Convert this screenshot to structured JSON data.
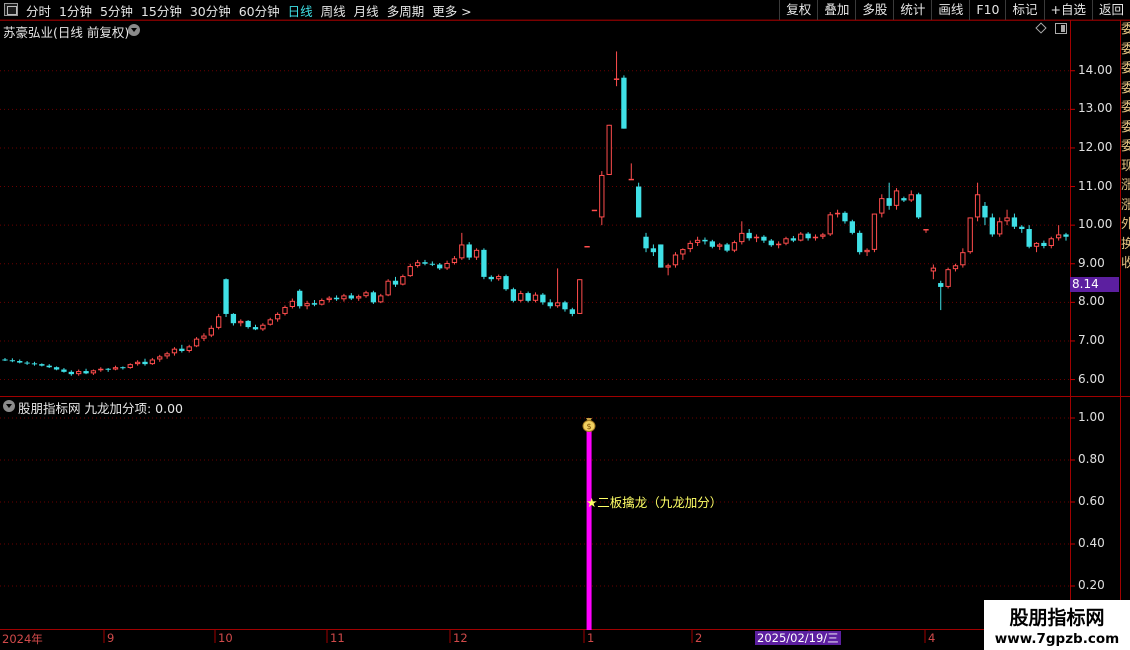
{
  "toolbar": {
    "period_tabs": [
      {
        "label": "分时",
        "active": false
      },
      {
        "label": "1分钟",
        "active": false
      },
      {
        "label": "5分钟",
        "active": false
      },
      {
        "label": "15分钟",
        "active": false
      },
      {
        "label": "30分钟",
        "active": false
      },
      {
        "label": "60分钟",
        "active": false
      },
      {
        "label": "日线",
        "active": true
      },
      {
        "label": "周线",
        "active": false
      },
      {
        "label": "月线",
        "active": false
      },
      {
        "label": "多周期",
        "active": false
      },
      {
        "label": "更多 >",
        "active": false
      }
    ],
    "right_tools": [
      "复权",
      "叠加",
      "多股",
      "统计",
      "画线",
      "F10",
      "标记",
      "+自选",
      "返回"
    ]
  },
  "main_chart": {
    "title": "苏豪弘业(日线 前复权)",
    "y_ticks": [
      "14.00",
      "13.00",
      "12.00",
      "11.00",
      "10.00",
      "9.00",
      "8.00",
      "7.00",
      "6.00"
    ],
    "current_price_tag": "8.14"
  },
  "indicator": {
    "title": "股朋指标网 九龙加分项: 0.00",
    "y_ticks": [
      "1.00",
      "0.80",
      "0.60",
      "0.40",
      "0.20"
    ],
    "signal_label": "★二板擒龙（九龙加分）"
  },
  "date_axis": {
    "labels": [
      "2024年",
      "9",
      "10",
      "11",
      "12",
      "1",
      "2",
      "3",
      "4"
    ],
    "cursor_date": "2025/02/19/三"
  },
  "side_column": [
    "委",
    "委",
    "委",
    "委",
    "委",
    "委",
    "委",
    "现",
    "涨",
    "涨",
    "外",
    "换",
    "收"
  ],
  "watermark": {
    "name": "股朋指标网",
    "url": "www.7gpzb.com"
  },
  "colors": {
    "up": "#ff4d4d",
    "down": "#3fe0e6",
    "grid": "#8a0000",
    "signal": "#ff00ff",
    "cursor": "#5c1fa0"
  },
  "chart_data": {
    "type": "candlestick",
    "price_range": [
      5.6,
      14.9
    ],
    "indicator_range": [
      0,
      1.1
    ],
    "candles": [
      [
        6.52,
        6.56,
        6.48,
        6.5
      ],
      [
        6.5,
        6.55,
        6.45,
        6.48
      ],
      [
        6.48,
        6.52,
        6.42,
        6.44
      ],
      [
        6.44,
        6.48,
        6.38,
        6.42
      ],
      [
        6.42,
        6.46,
        6.36,
        6.4
      ],
      [
        6.4,
        6.42,
        6.34,
        6.36
      ],
      [
        6.36,
        6.4,
        6.3,
        6.32
      ],
      [
        6.32,
        6.34,
        6.24,
        6.26
      ],
      [
        6.26,
        6.3,
        6.18,
        6.2
      ],
      [
        6.2,
        6.24,
        6.1,
        6.14
      ],
      [
        6.14,
        6.26,
        6.1,
        6.22
      ],
      [
        6.22,
        6.28,
        6.14,
        6.16
      ],
      [
        6.16,
        6.26,
        6.12,
        6.24
      ],
      [
        6.24,
        6.32,
        6.2,
        6.28
      ],
      [
        6.28,
        6.3,
        6.2,
        6.26
      ],
      [
        6.26,
        6.36,
        6.24,
        6.32
      ],
      [
        6.32,
        6.34,
        6.26,
        6.3
      ],
      [
        6.3,
        6.42,
        6.28,
        6.4
      ],
      [
        6.4,
        6.5,
        6.36,
        6.46
      ],
      [
        6.46,
        6.54,
        6.36,
        6.4
      ],
      [
        6.4,
        6.56,
        6.38,
        6.52
      ],
      [
        6.52,
        6.64,
        6.46,
        6.6
      ],
      [
        6.6,
        6.72,
        6.54,
        6.68
      ],
      [
        6.68,
        6.84,
        6.62,
        6.8
      ],
      [
        6.8,
        6.9,
        6.7,
        6.74
      ],
      [
        6.74,
        6.9,
        6.7,
        6.86
      ],
      [
        6.86,
        7.1,
        6.84,
        7.06
      ],
      [
        7.06,
        7.2,
        7.0,
        7.14
      ],
      [
        7.14,
        7.4,
        7.1,
        7.34
      ],
      [
        7.34,
        7.7,
        7.3,
        7.64
      ],
      [
        8.6,
        8.62,
        7.62,
        7.7
      ],
      [
        7.7,
        7.72,
        7.4,
        7.46
      ],
      [
        7.46,
        7.56,
        7.38,
        7.52
      ],
      [
        7.52,
        7.54,
        7.32,
        7.36
      ],
      [
        7.36,
        7.42,
        7.28,
        7.3
      ],
      [
        7.3,
        7.46,
        7.26,
        7.42
      ],
      [
        7.42,
        7.6,
        7.4,
        7.56
      ],
      [
        7.56,
        7.74,
        7.5,
        7.7
      ],
      [
        7.7,
        7.92,
        7.66,
        7.88
      ],
      [
        7.88,
        8.1,
        7.84,
        8.04
      ],
      [
        8.3,
        8.34,
        7.84,
        7.9
      ],
      [
        7.9,
        8.04,
        7.82,
        7.98
      ],
      [
        7.98,
        8.06,
        7.9,
        7.94
      ],
      [
        7.94,
        8.1,
        7.92,
        8.06
      ],
      [
        8.06,
        8.16,
        8.0,
        8.12
      ],
      [
        8.12,
        8.18,
        8.04,
        8.08
      ],
      [
        8.08,
        8.22,
        8.02,
        8.18
      ],
      [
        8.18,
        8.24,
        8.06,
        8.1
      ],
      [
        8.1,
        8.2,
        8.04,
        8.16
      ],
      [
        8.16,
        8.3,
        8.12,
        8.26
      ],
      [
        8.26,
        8.3,
        7.96,
        8.0
      ],
      [
        8.0,
        8.22,
        7.98,
        8.18
      ],
      [
        8.18,
        8.6,
        8.16,
        8.56
      ],
      [
        8.56,
        8.66,
        8.4,
        8.46
      ],
      [
        8.46,
        8.72,
        8.44,
        8.68
      ],
      [
        8.68,
        9.0,
        8.66,
        8.94
      ],
      [
        8.94,
        9.1,
        8.9,
        9.04
      ],
      [
        9.04,
        9.1,
        8.96,
        9.0
      ],
      [
        9.0,
        9.06,
        8.94,
        8.98
      ],
      [
        8.98,
        9.02,
        8.84,
        8.88
      ],
      [
        8.88,
        9.08,
        8.84,
        9.02
      ],
      [
        9.02,
        9.2,
        8.98,
        9.14
      ],
      [
        9.14,
        9.8,
        9.1,
        9.5
      ],
      [
        9.5,
        9.56,
        9.1,
        9.16
      ],
      [
        9.16,
        9.4,
        9.1,
        9.36
      ],
      [
        9.36,
        9.4,
        8.6,
        8.66
      ],
      [
        8.66,
        8.7,
        8.54,
        8.6
      ],
      [
        8.6,
        8.72,
        8.56,
        8.68
      ],
      [
        8.68,
        8.72,
        8.3,
        8.34
      ],
      [
        8.34,
        8.38,
        8.0,
        8.04
      ],
      [
        8.04,
        8.3,
        8.0,
        8.24
      ],
      [
        8.24,
        8.28,
        8.0,
        8.04
      ],
      [
        8.04,
        8.26,
        8.0,
        8.2
      ],
      [
        8.2,
        8.24,
        7.94,
        8.0
      ],
      [
        8.0,
        8.08,
        7.84,
        7.9
      ],
      [
        7.9,
        8.88,
        7.86,
        8.0
      ],
      [
        8.0,
        8.04,
        7.76,
        7.82
      ],
      [
        7.82,
        7.86,
        7.64,
        7.7
      ],
      [
        7.7,
        8.6,
        7.7,
        8.6
      ],
      [
        9.46,
        9.46,
        9.46,
        9.46
      ],
      [
        10.4,
        10.4,
        10.4,
        10.4
      ],
      [
        10.2,
        11.4,
        10.0,
        11.3
      ],
      [
        11.3,
        12.6,
        11.3,
        12.6
      ],
      [
        13.8,
        14.5,
        13.6,
        13.8
      ],
      [
        13.82,
        13.88,
        12.5,
        12.5
      ],
      [
        11.2,
        11.6,
        11.2,
        11.2
      ],
      [
        11.0,
        11.1,
        10.2,
        10.2
      ],
      [
        9.7,
        9.8,
        9.3,
        9.4
      ],
      [
        9.4,
        9.5,
        9.2,
        9.3
      ],
      [
        9.5,
        9.5,
        8.9,
        8.9
      ],
      [
        8.9,
        9.0,
        8.7,
        8.96
      ],
      [
        8.96,
        9.3,
        8.9,
        9.24
      ],
      [
        9.24,
        9.4,
        9.1,
        9.38
      ],
      [
        9.38,
        9.6,
        9.3,
        9.54
      ],
      [
        9.54,
        9.7,
        9.46,
        9.62
      ],
      [
        9.62,
        9.68,
        9.5,
        9.58
      ],
      [
        9.58,
        9.62,
        9.4,
        9.44
      ],
      [
        9.44,
        9.54,
        9.36,
        9.5
      ],
      [
        9.5,
        9.54,
        9.3,
        9.34
      ],
      [
        9.34,
        9.6,
        9.3,
        9.56
      ],
      [
        9.56,
        10.1,
        9.5,
        9.8
      ],
      [
        9.8,
        9.9,
        9.6,
        9.66
      ],
      [
        9.66,
        9.76,
        9.56,
        9.7
      ],
      [
        9.7,
        9.74,
        9.54,
        9.6
      ],
      [
        9.6,
        9.64,
        9.44,
        9.48
      ],
      [
        9.48,
        9.58,
        9.4,
        9.52
      ],
      [
        9.52,
        9.7,
        9.48,
        9.66
      ],
      [
        9.66,
        9.72,
        9.56,
        9.6
      ],
      [
        9.6,
        9.82,
        9.58,
        9.78
      ],
      [
        9.78,
        9.82,
        9.6,
        9.66
      ],
      [
        9.66,
        9.76,
        9.6,
        9.7
      ],
      [
        9.7,
        9.8,
        9.64,
        9.76
      ],
      [
        9.76,
        10.34,
        9.72,
        10.28
      ],
      [
        10.28,
        10.4,
        10.2,
        10.32
      ],
      [
        10.32,
        10.36,
        10.04,
        10.1
      ],
      [
        10.1,
        10.14,
        9.76,
        9.8
      ],
      [
        9.8,
        9.86,
        9.24,
        9.3
      ],
      [
        9.3,
        9.4,
        9.2,
        9.36
      ],
      [
        9.36,
        10.3,
        9.3,
        10.3
      ],
      [
        10.3,
        10.8,
        10.2,
        10.7
      ],
      [
        10.7,
        11.1,
        10.4,
        10.5
      ],
      [
        10.5,
        10.96,
        10.4,
        10.9
      ],
      [
        10.7,
        10.74,
        10.6,
        10.64
      ],
      [
        10.64,
        10.9,
        10.6,
        10.8
      ],
      [
        10.8,
        10.84,
        10.16,
        10.2
      ],
      [
        9.9,
        9.9,
        9.8,
        9.9
      ],
      [
        8.8,
        8.98,
        8.6,
        8.9
      ],
      [
        8.5,
        8.56,
        7.8,
        8.4
      ],
      [
        8.4,
        8.9,
        8.36,
        8.86
      ],
      [
        8.86,
        9.0,
        8.8,
        8.96
      ],
      [
        8.96,
        9.4,
        8.9,
        9.3
      ],
      [
        9.3,
        10.2,
        9.26,
        10.2
      ],
      [
        10.2,
        11.1,
        10.1,
        10.8
      ],
      [
        10.5,
        10.6,
        10.0,
        10.2
      ],
      [
        10.2,
        10.3,
        9.7,
        9.76
      ],
      [
        9.76,
        10.2,
        9.7,
        10.1
      ],
      [
        10.1,
        10.4,
        10.0,
        10.2
      ],
      [
        10.2,
        10.3,
        9.9,
        9.96
      ],
      [
        9.96,
        10.0,
        9.8,
        9.9
      ],
      [
        9.9,
        10.0,
        9.4,
        9.44
      ],
      [
        9.44,
        9.56,
        9.3,
        9.54
      ],
      [
        9.54,
        9.6,
        9.4,
        9.46
      ],
      [
        9.46,
        9.7,
        9.4,
        9.66
      ],
      [
        9.66,
        10.0,
        9.6,
        9.76
      ],
      [
        9.76,
        9.8,
        9.6,
        9.7
      ]
    ],
    "signal": {
      "index": 79,
      "value": 1.0
    }
  }
}
